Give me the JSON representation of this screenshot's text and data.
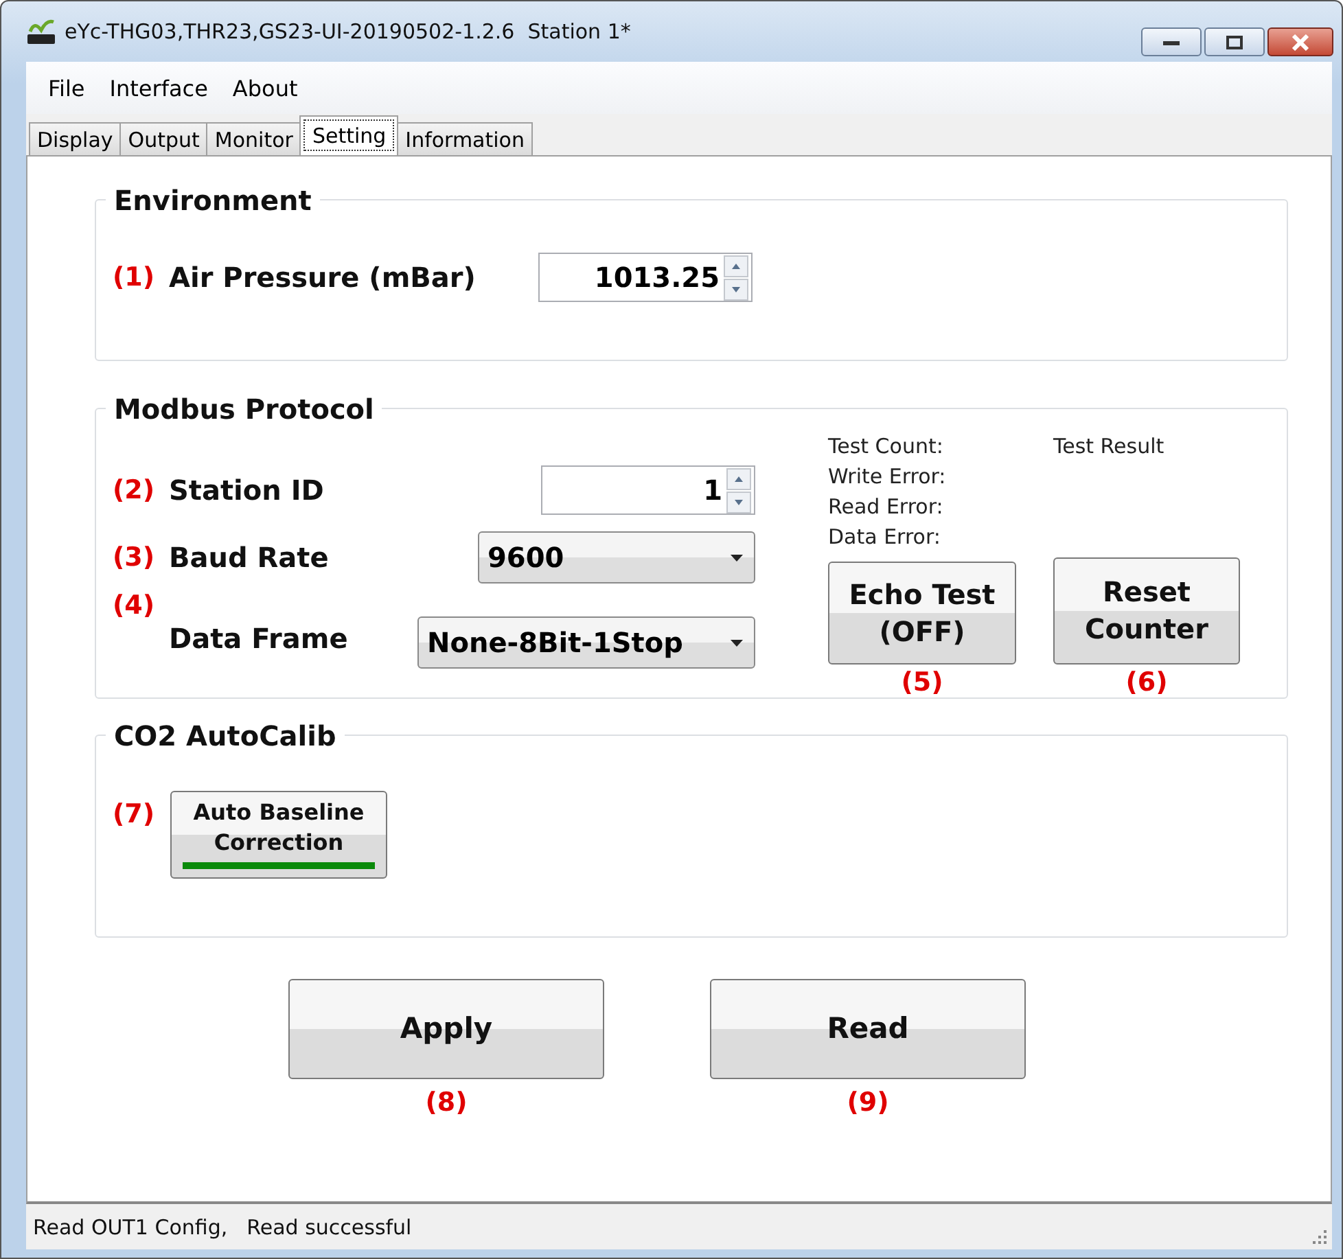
{
  "window": {
    "title": "eYc-THG03,THR23,GS23-UI-20190502-1.2.6  Station 1*"
  },
  "menu": [
    {
      "label": "File"
    },
    {
      "label": "Interface"
    },
    {
      "label": "About"
    }
  ],
  "tabs": [
    {
      "label": "Display",
      "selected": false
    },
    {
      "label": "Output",
      "selected": false
    },
    {
      "label": "Monitor",
      "selected": false
    },
    {
      "label": "Setting",
      "selected": true
    },
    {
      "label": "Information",
      "selected": false
    }
  ],
  "environment": {
    "title": "Environment",
    "fields": [
      {
        "marker": "(1)",
        "label": "Air Pressure (mBar)",
        "kind": "spin",
        "value": "1013.25"
      }
    ]
  },
  "modbus": {
    "title": "Modbus Protocol",
    "fields": [
      {
        "marker": "(2)",
        "label": "Station ID",
        "kind": "spin",
        "value": "1"
      },
      {
        "marker": "(3)",
        "label": "Baud Rate",
        "kind": "combo",
        "value": "9600"
      },
      {
        "marker": "(4)",
        "label": "Data Frame",
        "kind": "combo",
        "value": "None-8Bit-1Stop"
      }
    ],
    "stats": [
      "Test Count:",
      "Write Error:",
      "Read Error:",
      "Data Error:"
    ],
    "result_label": "Test Result",
    "buttons": [
      {
        "label": "Echo Test (OFF)",
        "marker": "(5)"
      },
      {
        "label": "Reset Counter",
        "marker": "(6)"
      }
    ]
  },
  "co2": {
    "title": "CO2 AutoCalib",
    "toggle": {
      "marker": "(7)",
      "label": "Auto Baseline Correction",
      "on": true
    }
  },
  "actions": [
    {
      "label": "Apply",
      "marker": "(8)"
    },
    {
      "label": "Read",
      "marker": "(9)"
    }
  ],
  "status_bar": {
    "items": [
      "Read OUT1 Config,",
      "Read successful"
    ]
  }
}
